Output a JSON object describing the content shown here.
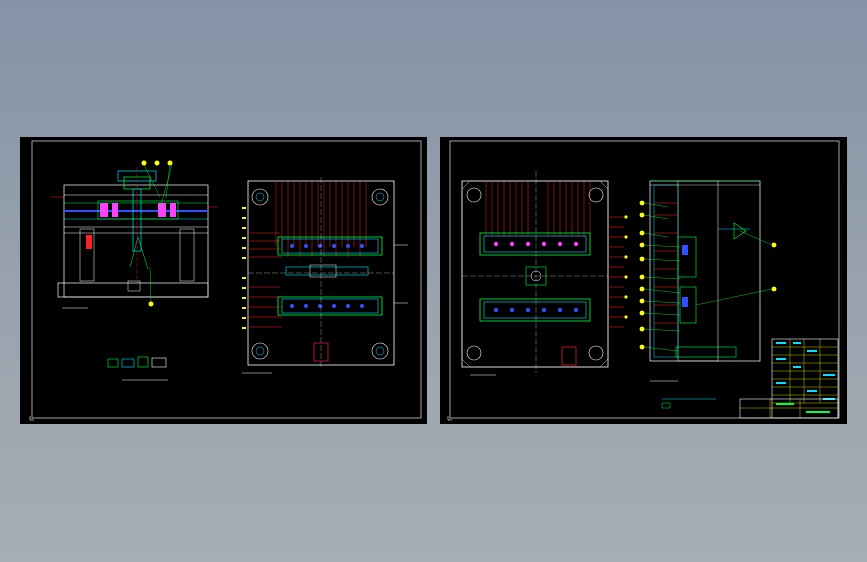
{
  "colors": {
    "background_top": "#8593a7",
    "background_bottom": "#a7adb4",
    "sheet": "#000000",
    "frame": "#d8d8d8",
    "red": "#ff2020",
    "cyan": "#00e5ff",
    "green": "#00ff40",
    "yellow": "#ffff00",
    "magenta": "#ff40ff",
    "blue": "#3050ff",
    "white": "#ffffff"
  },
  "sheets": [
    {
      "id": "sheet-left",
      "views": [
        "front-section-view",
        "top-plan-view"
      ]
    },
    {
      "id": "sheet-right",
      "views": [
        "moving-half-plan-view",
        "side-section-view",
        "title-block"
      ]
    }
  ],
  "icons": [
    "balloon-marker-icon",
    "bolt-hole-icon",
    "cavity-insert-icon",
    "sprue-icon"
  ]
}
